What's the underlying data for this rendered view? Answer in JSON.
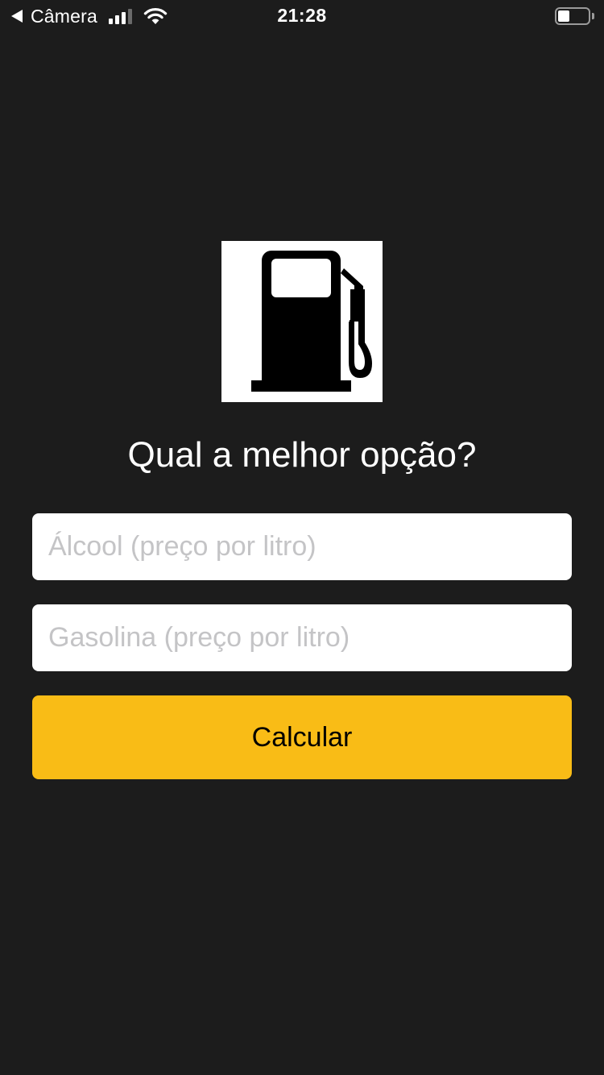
{
  "status_bar": {
    "back_app_label": "Câmera",
    "time": "21:28",
    "battery_level": 0.4,
    "icons": [
      "back-arrow-icon",
      "signal-icon",
      "wifi-icon",
      "battery-icon"
    ]
  },
  "logo": {
    "icon": "fuel-pump-icon"
  },
  "main": {
    "title": "Qual a melhor opção?",
    "alcool_placeholder": "Álcool (preço por litro)",
    "alcool_value": "",
    "gasolina_placeholder": "Gasolina (preço por litro)",
    "gasolina_value": "",
    "calculate_label": "Calcular"
  },
  "colors": {
    "background": "#1c1c1c",
    "accent": "#f9bc16",
    "field_background": "#ffffff",
    "placeholder": "#c4c4c6"
  }
}
